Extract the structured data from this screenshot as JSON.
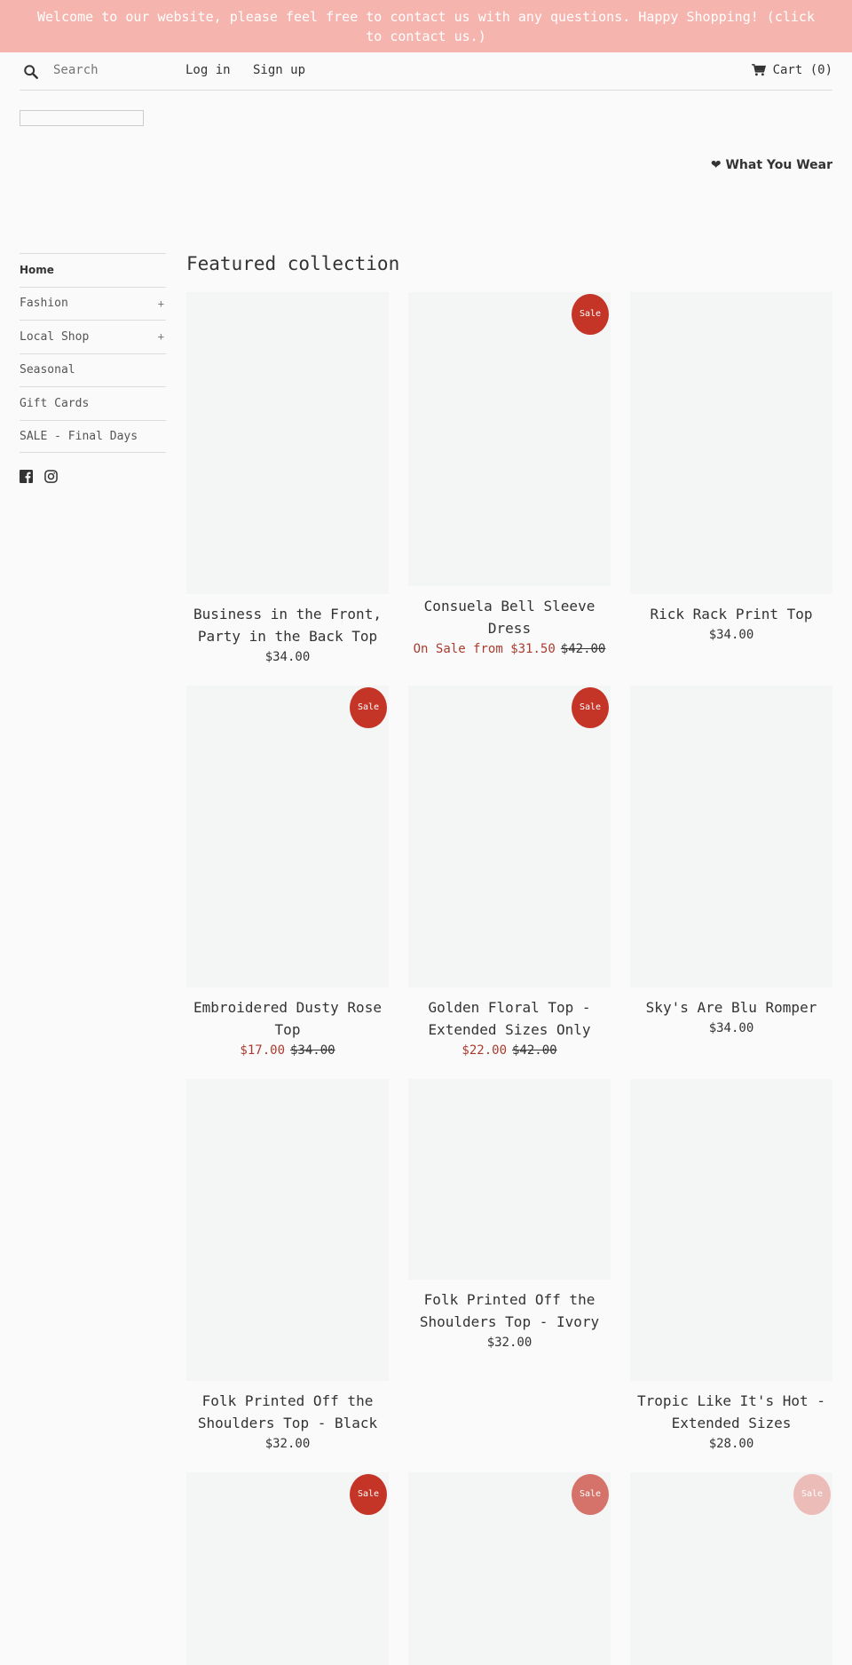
{
  "announcement": "Welcome to our website, please feel free to contact us with any questions. Happy Shopping! (click to contact us.)",
  "header": {
    "search_placeholder": "Search",
    "login": "Log in",
    "signup": "Sign up",
    "cart": "Cart (0)"
  },
  "tagline": "❤ What You Wear",
  "sidebar": {
    "items": [
      {
        "label": "Home",
        "expandable": false
      },
      {
        "label": "Fashion",
        "expandable": true
      },
      {
        "label": "Local Shop",
        "expandable": true
      },
      {
        "label": "Seasonal",
        "expandable": false
      },
      {
        "label": "Gift Cards",
        "expandable": false
      },
      {
        "label": "SALE - Final Days",
        "expandable": false
      }
    ],
    "expand_symbol": "+",
    "socials": [
      "facebook-icon",
      "instagram-icon"
    ]
  },
  "collection": {
    "title": "Featured collection",
    "sale_badge": "Sale",
    "products": [
      {
        "name": "Business in the Front, Party in the Back Top",
        "price": "$34.00",
        "sale_price": "",
        "original_price": "",
        "on_sale": false
      },
      {
        "name": "Consuela Bell Sleeve Dress",
        "price": "",
        "sale_price": "On Sale from $31.50",
        "original_price": "$42.00",
        "on_sale": true
      },
      {
        "name": "Rick Rack Print Top",
        "price": "$34.00",
        "sale_price": "",
        "original_price": "",
        "on_sale": false
      },
      {
        "name": "Embroidered Dusty Rose Top",
        "price": "",
        "sale_price": "$17.00",
        "original_price": "$34.00",
        "on_sale": true
      },
      {
        "name": "Golden Floral Top - Extended Sizes Only",
        "price": "",
        "sale_price": "$22.00",
        "original_price": "$42.00",
        "on_sale": true
      },
      {
        "name": "Sky's Are Blu Romper",
        "price": "$34.00",
        "sale_price": "",
        "original_price": "",
        "on_sale": false
      },
      {
        "name": "Folk Printed Off the Shoulders Top - Black",
        "price": "$32.00",
        "sale_price": "",
        "original_price": "",
        "on_sale": false
      },
      {
        "name": "Folk Printed Off the Shoulders Top - Ivory",
        "price": "$32.00",
        "sale_price": "",
        "original_price": "",
        "on_sale": false
      },
      {
        "name": "Tropic Like It's Hot - Extended Sizes",
        "price": "$28.00",
        "sale_price": "",
        "original_price": "",
        "on_sale": false
      },
      {
        "name": "",
        "price": "",
        "sale_price": "",
        "original_price": "",
        "on_sale": true
      },
      {
        "name": "",
        "price": "",
        "sale_price": "",
        "original_price": "",
        "on_sale": true
      },
      {
        "name": "",
        "price": "",
        "sale_price": "",
        "original_price": "",
        "on_sale": true
      }
    ]
  },
  "colors": {
    "announcement_bg": "#f5b5ae",
    "sale_red": "#c53527",
    "sale_price_text": "#a93c2f",
    "page_bg": "#fafafa"
  }
}
